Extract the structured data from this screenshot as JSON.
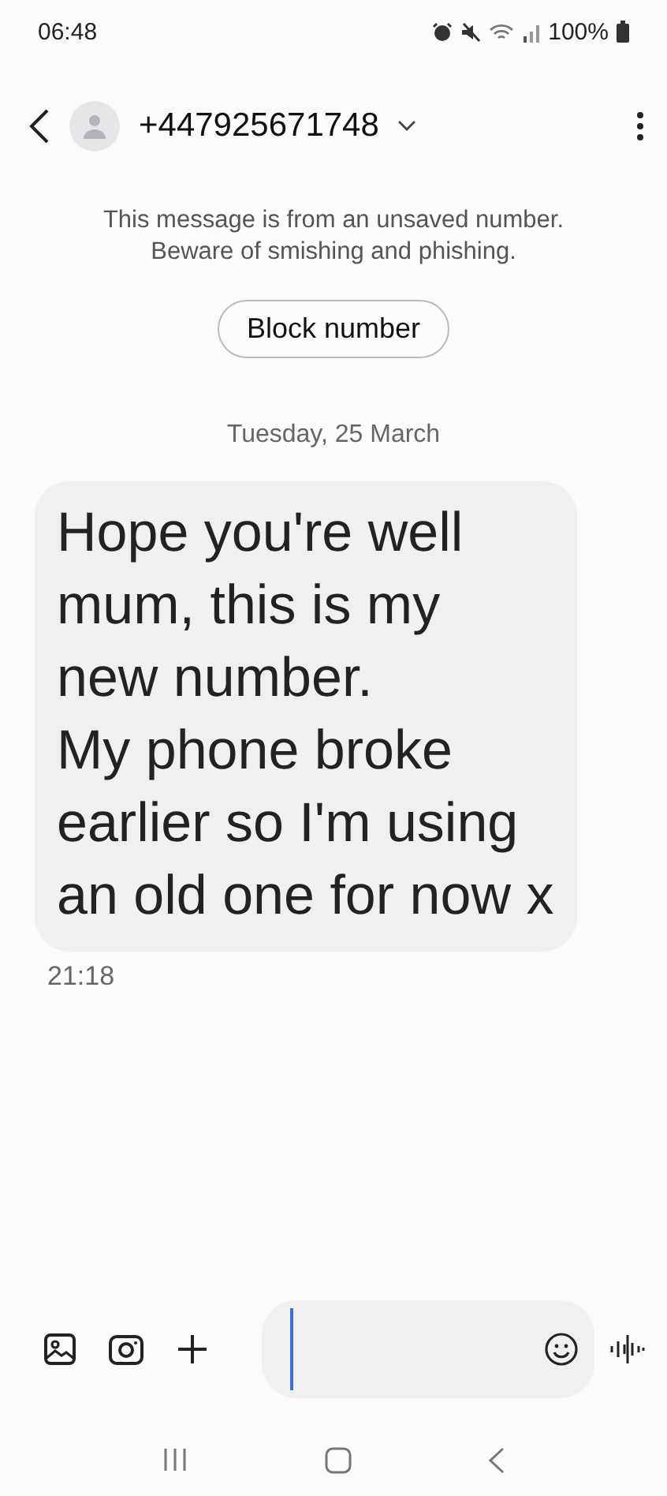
{
  "status_bar": {
    "time": "06:48",
    "battery": "100%"
  },
  "header": {
    "contact": "+447925671748"
  },
  "notice": {
    "text": "This message is from an unsaved number.\nBeware of smishing and phishing.",
    "button": "Block number"
  },
  "date": "Tuesday, 25 March",
  "messages": [
    {
      "text": "Hope you're well mum, this is my new number.\nMy phone broke earlier so I'm using an old one for now x",
      "time": "21:18"
    }
  ]
}
